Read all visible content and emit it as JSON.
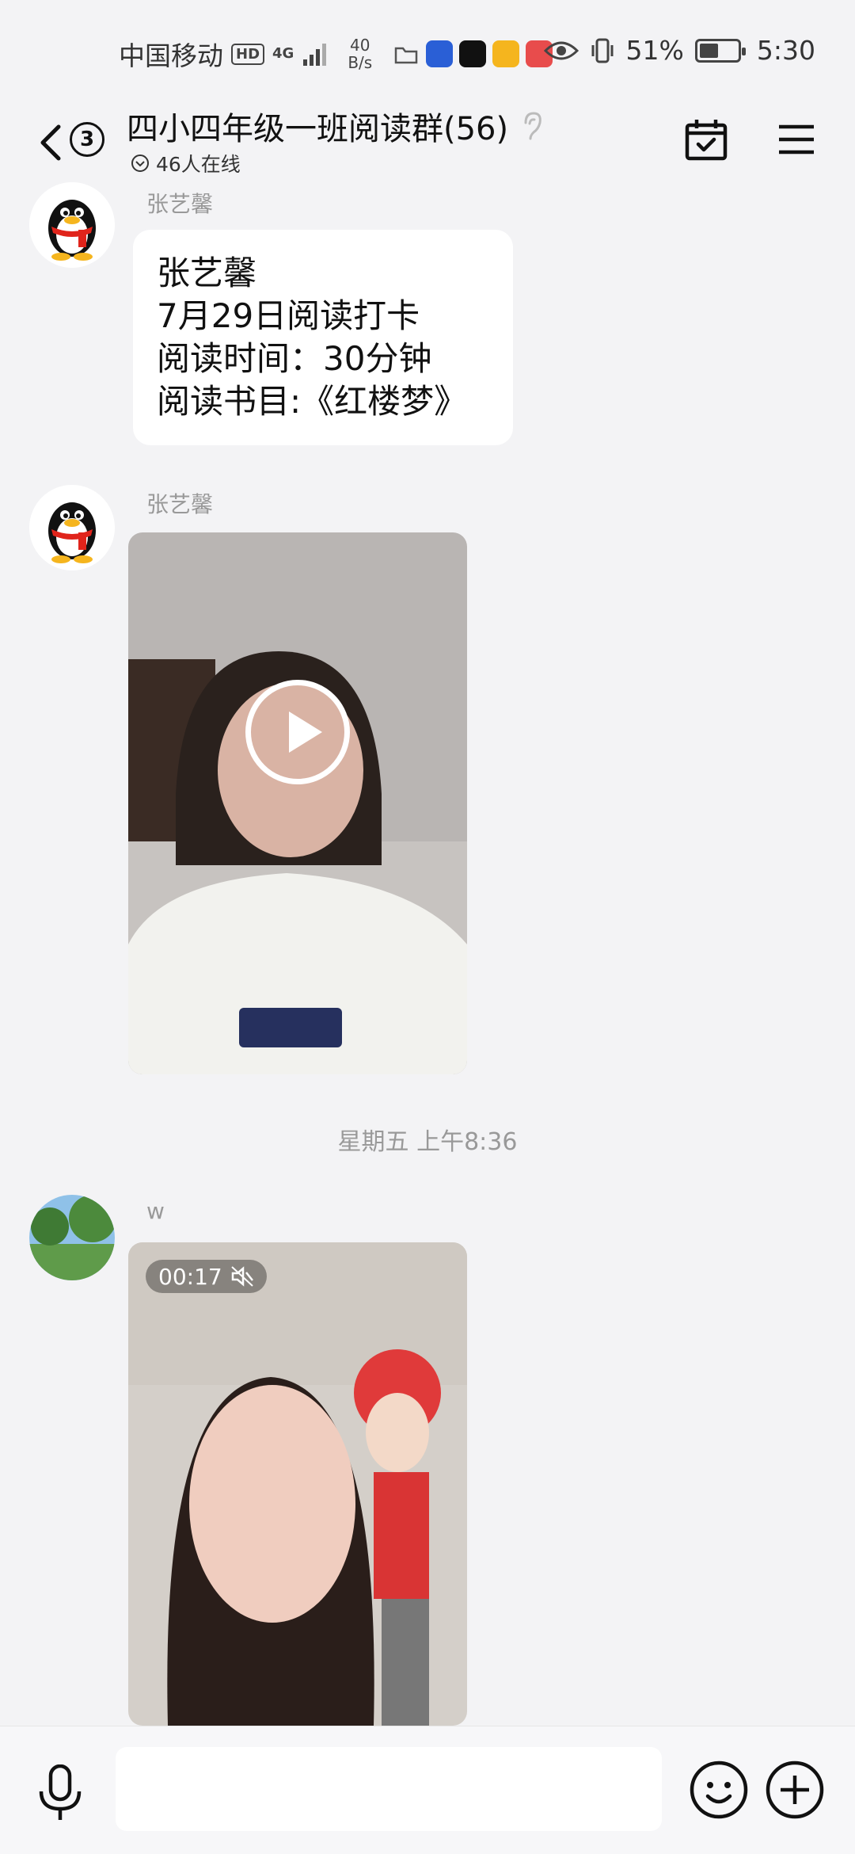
{
  "status_bar": {
    "carrier": "中国移动",
    "hd": "HD",
    "network": "4G",
    "speed_value": "40",
    "speed_unit": "B/s",
    "battery_percent": "51%",
    "battery_level": 0.51,
    "time": "5:30"
  },
  "header": {
    "unread_count": "3",
    "title": "四小四年级一班阅读群(56)",
    "online_status": "46人在线"
  },
  "messages": [
    {
      "sender": "张艺馨",
      "type": "text",
      "lines": [
        "张艺馨",
        "7月29日阅读打卡",
        "阅读时间：30分钟",
        "阅读书目:《红楼梦》"
      ]
    },
    {
      "sender": "张艺馨",
      "type": "video"
    },
    {
      "sender": "w",
      "type": "video",
      "duration": "00:17"
    }
  ],
  "timestamp_divider": "星期五 上午8:36",
  "input": {
    "placeholder": ""
  },
  "icons": {
    "back": "back-chevron-icon",
    "calendar": "calendar-check-icon",
    "menu": "menu-icon",
    "mic": "microphone-icon",
    "emoji": "emoji-icon",
    "plus": "plus-icon",
    "play": "play-icon",
    "mute": "muted-speaker-icon",
    "ear": "ear-icon"
  },
  "colors": {
    "background": "#f3f3f5",
    "bubble": "#ffffff",
    "secondary_text": "#999999"
  }
}
